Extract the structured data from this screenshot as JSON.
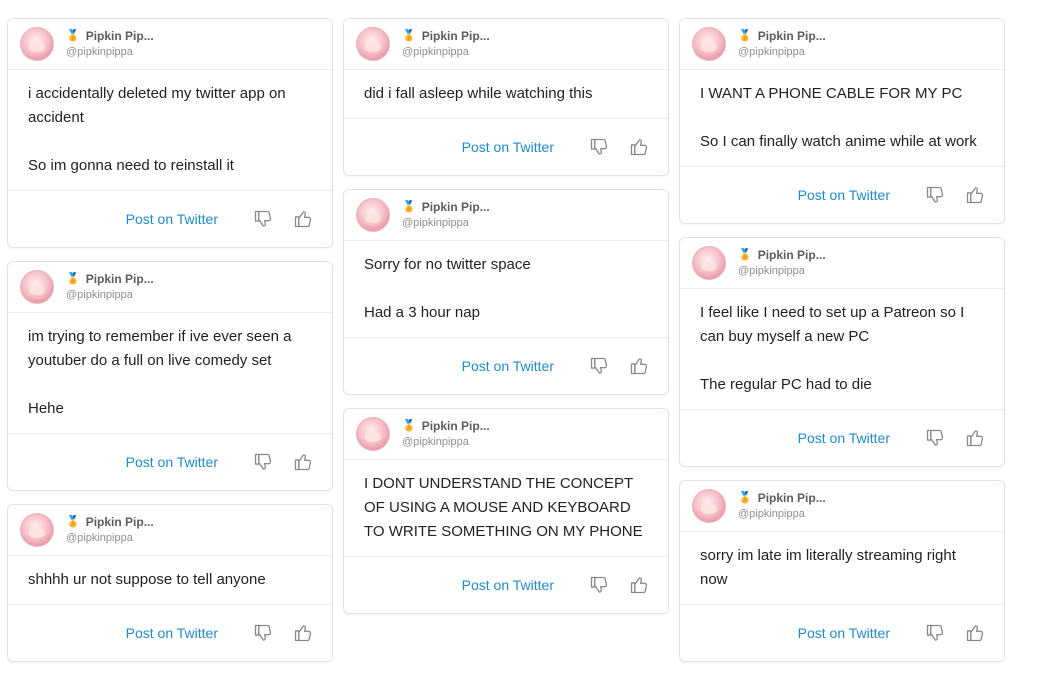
{
  "author": {
    "name": "Pipkin Pip...",
    "handle": "@pipkinpippa",
    "medal_icon": "medal-icon"
  },
  "action_label": "Post on Twitter",
  "colors": {
    "link": "#1d8bd1",
    "border": "#e3e3e3",
    "icon": "#8a8a8a"
  },
  "columns": [
    [
      {
        "lines": [
          "i accidentally deleted my twitter app on accident",
          "",
          "So im gonna need to reinstall it"
        ]
      },
      {
        "lines": [
          "im trying to remember if ive ever seen a youtuber do a full on live comedy set",
          "",
          "Hehe"
        ]
      },
      {
        "lines": [
          "shhhh ur not suppose to tell anyone"
        ]
      }
    ],
    [
      {
        "lines": [
          "did i fall asleep while watching this"
        ]
      },
      {
        "lines": [
          "Sorry for no twitter space",
          "",
          "Had a 3 hour nap"
        ]
      },
      {
        "lines": [
          "I DONT UNDERSTAND THE CONCEPT OF USING A MOUSE AND KEYBOARD TO WRITE SOMETHING ON MY PHONE"
        ]
      }
    ],
    [
      {
        "lines": [
          "I WANT A PHONE CABLE FOR MY PC",
          "",
          "So I can finally watch anime while at work"
        ]
      },
      {
        "lines": [
          "I feel like I need to set up a Patreon so I can buy myself a new PC",
          "",
          "The regular PC had to die"
        ]
      },
      {
        "lines": [
          "sorry im late im literally streaming right now"
        ]
      }
    ]
  ]
}
